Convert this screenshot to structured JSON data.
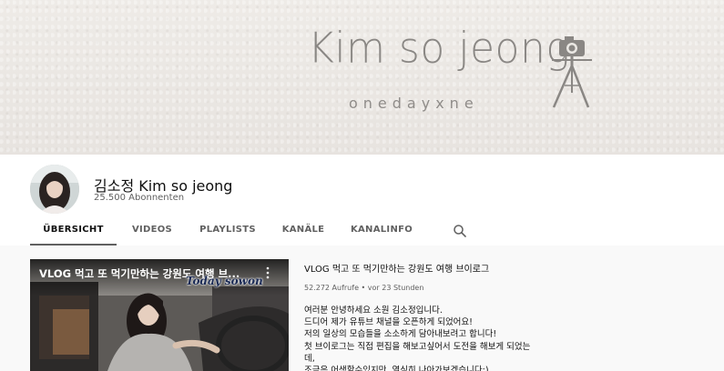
{
  "banner": {
    "title": "Kim so jeong",
    "subtitle": "onedayxne",
    "camera_icon": "camera-on-tripod-icon"
  },
  "channel": {
    "name": "김소정 Kim so jeong",
    "subscribers": "25.500 Abonnenten"
  },
  "tabs": [
    {
      "label": "ÜBERSICHT",
      "active": true
    },
    {
      "label": "VIDEOS",
      "active": false
    },
    {
      "label": "PLAYLISTS",
      "active": false
    },
    {
      "label": "KANÄLE",
      "active": false
    },
    {
      "label": "KANALINFO",
      "active": false
    }
  ],
  "search_icon": "search-icon",
  "featured": {
    "thumb_title": "VLOG 먹고 또 먹기만하는 강원도 여행 브...",
    "thumb_watermark": "Today sowon",
    "title": "VLOG 먹고 또 먹기만하는 강원도 여행 브이로그",
    "meta": "52.272 Aufrufe • vor 23 Stunden",
    "description": [
      "여러분 안녕하세요 소원 김소정입니다.",
      "드디어 제가 유튜브 채널을 오픈하게 되었어요!",
      "저의 일상의 모습들을 소소하게 담아내보려고 합니다!",
      "첫 브이로그는 직접 편집을 해보고싶어서 도전을 해보게 되었는",
      "데,",
      "조금은 어색할수있지만, 열심히 나아가보겠습니다:)"
    ]
  },
  "colors": {
    "banner_bg": "#ebe8e4",
    "header_bg": "#ffffff",
    "page_bg": "#f9f9f9",
    "text_primary": "#0f0f0f",
    "text_secondary": "#606060"
  }
}
